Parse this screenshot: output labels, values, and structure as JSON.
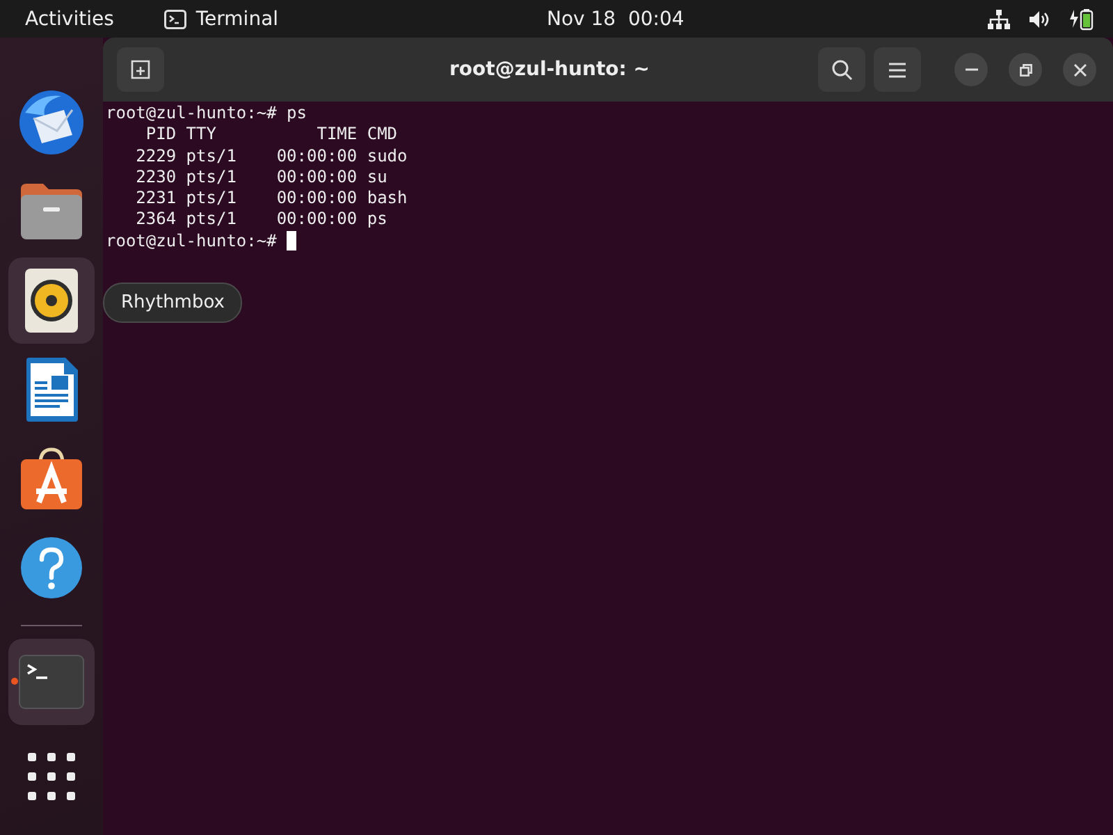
{
  "top_bar": {
    "activities": "Activities",
    "app_name": "Terminal",
    "clock": "Nov 18  00:04"
  },
  "dock": {
    "favorites": [
      {
        "kind": "mail",
        "highlighted": false,
        "running": false
      },
      {
        "kind": "files",
        "highlighted": false,
        "running": false
      },
      {
        "kind": "music",
        "highlighted": true,
        "running": false
      },
      {
        "kind": "writer",
        "highlighted": false,
        "running": false
      },
      {
        "kind": "store",
        "highlighted": false,
        "running": false
      },
      {
        "kind": "help",
        "highlighted": false,
        "running": false
      }
    ],
    "others": [
      {
        "kind": "terminal",
        "highlighted": true,
        "running": true
      }
    ]
  },
  "tooltip": "Rhythmbox",
  "window": {
    "title": "root@zul-hunto: ~",
    "lines": [
      "root@zul-hunto:~# ps",
      "    PID TTY          TIME CMD",
      "   2229 pts/1    00:00:00 sudo",
      "   2230 pts/1    00:00:00 su",
      "   2231 pts/1    00:00:00 bash",
      "   2364 pts/1    00:00:00 ps"
    ],
    "prompt": "root@zul-hunto:~#"
  }
}
